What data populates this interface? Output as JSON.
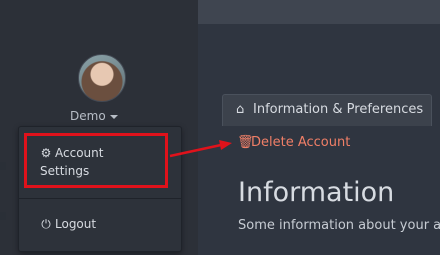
{
  "user_menu": {
    "name": "Demo",
    "items": [
      {
        "label_line1": "Account",
        "label_line2": "Settings",
        "icon": "gear-icon"
      },
      {
        "label": "Logout",
        "icon": "power-icon"
      }
    ]
  },
  "main": {
    "tab_label": "Information & Preferences",
    "delete_label": "Delete Account",
    "heading": "Information",
    "description": "Some information about your ac"
  },
  "colors": {
    "highlight": "#e0121b",
    "danger_link": "#f07f67"
  }
}
